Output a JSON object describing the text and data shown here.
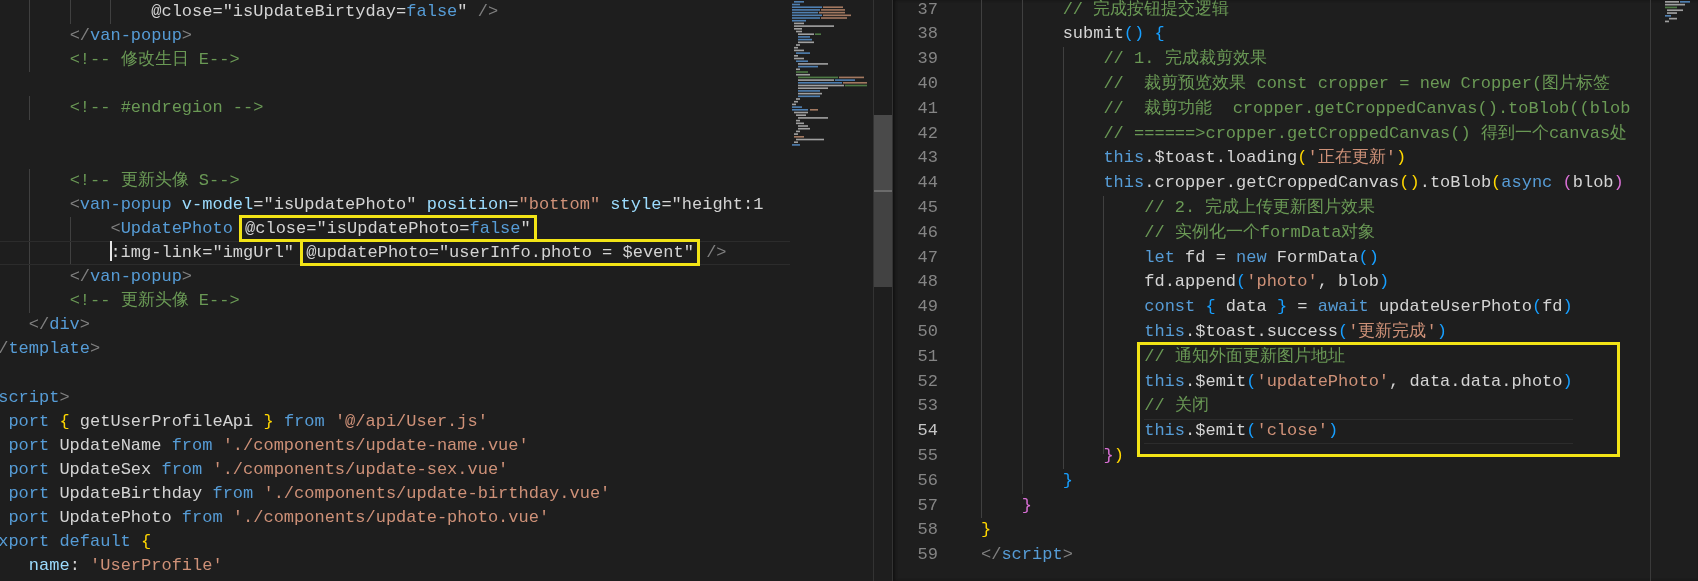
{
  "left_editor": {
    "lines": [
      {
        "current": false,
        "tokens": [
          {
            "kind": "text",
            "text": "                @close=\"isUpdateBirtyday="
          },
          {
            "kind": "keyword",
            "text": "false"
          },
          {
            "kind": "text",
            "text": "\""
          },
          {
            "kind": "punct",
            "text": " />"
          }
        ]
      },
      {
        "current": false,
        "tokens": [
          {
            "kind": "punct",
            "text": "        </"
          },
          {
            "kind": "tag",
            "text": "van-popup"
          },
          {
            "kind": "punct",
            "text": ">"
          }
        ]
      },
      {
        "current": false,
        "tokens": [
          {
            "kind": "comment",
            "text": "        <!-- 修改生日 E-->"
          }
        ]
      },
      {
        "current": false
      },
      {
        "current": false,
        "tokens": [
          {
            "kind": "comment",
            "text": "        <!-- #endregion -->"
          }
        ]
      },
      {
        "current": false
      },
      {
        "current": false
      },
      {
        "current": false,
        "tokens": [
          {
            "kind": "comment",
            "text": "        <!-- 更新头像 S-->"
          }
        ]
      },
      {
        "current": false,
        "tokens": [
          {
            "kind": "punct",
            "text": "        <"
          },
          {
            "kind": "tag",
            "text": "van-popup"
          },
          {
            "kind": "attr",
            "text": " v-model"
          },
          {
            "kind": "text",
            "text": "=\"isUpdatePhoto\""
          },
          {
            "kind": "attr",
            "text": " position"
          },
          {
            "kind": "text",
            "text": "="
          },
          {
            "kind": "string",
            "text": "\"bottom\""
          },
          {
            "kind": "attr",
            "text": " style"
          },
          {
            "kind": "text",
            "text": "=\"height:1"
          }
        ]
      },
      {
        "current": false,
        "tokens": [
          {
            "kind": "punct",
            "text": "            <"
          },
          {
            "kind": "tag",
            "text": "UpdatePhoto "
          },
          {
            "kind": "box",
            "tokens": [
              {
                "kind": "text",
                "text": "@close=\"isUpdatePhoto="
              },
              {
                "kind": "keyword",
                "text": "false"
              },
              {
                "kind": "text",
                "text": "\""
              }
            ]
          }
        ]
      },
      {
        "current": true,
        "tokens": [
          {
            "kind": "text",
            "text": "            :img-link=\"imgUrl\" "
          },
          {
            "kind": "box",
            "tokens": [
              {
                "kind": "text",
                "text": "@updatePhoto=\"userInfo.photo = $event\""
              }
            ]
          },
          {
            "kind": "punct",
            "text": " />"
          }
        ]
      },
      {
        "current": false,
        "tokens": [
          {
            "kind": "punct",
            "text": "        </"
          },
          {
            "kind": "tag",
            "text": "van-popup"
          },
          {
            "kind": "punct",
            "text": ">"
          }
        ]
      },
      {
        "current": false,
        "tokens": [
          {
            "kind": "comment",
            "text": "        <!-- 更新头像 E-->"
          }
        ]
      },
      {
        "current": false,
        "tokens": [
          {
            "kind": "punct",
            "text": "    </"
          },
          {
            "kind": "tag",
            "text": "div"
          },
          {
            "kind": "punct",
            "text": ">"
          }
        ]
      },
      {
        "current": false,
        "tokens": [
          {
            "kind": "punct",
            "text": " /"
          },
          {
            "kind": "tag",
            "text": "template"
          },
          {
            "kind": "punct",
            "text": ">"
          }
        ]
      },
      {
        "current": false
      },
      {
        "current": false,
        "tokens": [
          {
            "kind": "tag",
            "text": " script"
          },
          {
            "kind": "punct",
            "text": ">"
          }
        ]
      },
      {
        "current": false,
        "tokens": [
          {
            "kind": "keyword",
            "text": "  port "
          },
          {
            "kind": "bracket_gold",
            "text": "{"
          },
          {
            "kind": "text",
            "text": " getUserProfileApi "
          },
          {
            "kind": "bracket_gold",
            "text": "} "
          },
          {
            "kind": "keyword",
            "text": "from "
          },
          {
            "kind": "string",
            "text": "'@/api/User.js'"
          }
        ]
      },
      {
        "current": false,
        "tokens": [
          {
            "kind": "keyword",
            "text": "  port"
          },
          {
            "kind": "text",
            "text": " UpdateName "
          },
          {
            "kind": "keyword",
            "text": "from "
          },
          {
            "kind": "string",
            "text": "'./components/update-name.vue'"
          }
        ]
      },
      {
        "current": false,
        "tokens": [
          {
            "kind": "keyword",
            "text": "  port"
          },
          {
            "kind": "text",
            "text": " UpdateSex "
          },
          {
            "kind": "keyword",
            "text": "from "
          },
          {
            "kind": "string",
            "text": "'./components/update-sex.vue'"
          }
        ]
      },
      {
        "current": false,
        "tokens": [
          {
            "kind": "keyword",
            "text": "  port"
          },
          {
            "kind": "text",
            "text": " UpdateBirthday "
          },
          {
            "kind": "keyword",
            "text": "from "
          },
          {
            "kind": "string",
            "text": "'./components/update-birthday.vue'"
          }
        ]
      },
      {
        "current": false,
        "tokens": [
          {
            "kind": "keyword",
            "text": "  port"
          },
          {
            "kind": "text",
            "text": " UpdatePhoto "
          },
          {
            "kind": "keyword",
            "text": "from "
          },
          {
            "kind": "string",
            "text": "'./components/update-photo.vue'"
          }
        ]
      },
      {
        "current": false,
        "tokens": [
          {
            "kind": "keyword",
            "text": " xport default "
          },
          {
            "kind": "bracket_gold",
            "text": "{"
          }
        ]
      },
      {
        "current": false,
        "tokens": [
          {
            "kind": "attr",
            "text": "    name"
          },
          {
            "kind": "text",
            "text": ": "
          },
          {
            "kind": "string",
            "text": "'UserProfile'"
          }
        ]
      }
    ]
  },
  "right_editor": {
    "lines": [
      {
        "kind": "line",
        "number": "37",
        "current": false,
        "tokens": [
          {
            "kind": "comment",
            "text": "        // 完成按钮提交逻辑"
          }
        ]
      },
      {
        "kind": "line",
        "number": "38",
        "current": false,
        "tokens": [
          {
            "kind": "text",
            "text": "        submit"
          },
          {
            "kind": "bracket_blue",
            "text": "() "
          },
          {
            "kind": "bracket_blue",
            "text": "{"
          }
        ]
      },
      {
        "kind": "line",
        "number": "39",
        "current": false,
        "tokens": [
          {
            "kind": "comment",
            "text": "            // 1. 完成裁剪效果"
          }
        ]
      },
      {
        "kind": "line",
        "number": "40",
        "current": false,
        "tokens": [
          {
            "kind": "comment",
            "text": "            //  裁剪预览效果 const cropper = new Cropper(图片标签"
          }
        ]
      },
      {
        "kind": "line",
        "number": "41",
        "current": false,
        "tokens": [
          {
            "kind": "comment",
            "text": "            //  裁剪功能  cropper.getCroppedCanvas().toBlob((blob"
          }
        ]
      },
      {
        "kind": "line",
        "number": "42",
        "current": false,
        "tokens": [
          {
            "kind": "comment",
            "text": "            // ======>cropper.getCroppedCanvas() 得到一个canvas处"
          }
        ]
      },
      {
        "kind": "line",
        "number": "43",
        "current": false,
        "tokens": [
          {
            "kind": "keyword",
            "text": "            this"
          },
          {
            "kind": "text",
            "text": ".$toast.loading"
          },
          {
            "kind": "bracket_gold",
            "text": "("
          },
          {
            "kind": "string",
            "text": "'正在更新'"
          },
          {
            "kind": "bracket_gold",
            "text": ")"
          }
        ]
      },
      {
        "kind": "line",
        "number": "44",
        "current": false,
        "tokens": [
          {
            "kind": "keyword",
            "text": "            this"
          },
          {
            "kind": "text",
            "text": ".cropper.getCroppedCanvas"
          },
          {
            "kind": "bracket_gold",
            "text": "()"
          },
          {
            "kind": "text",
            "text": ".toBlob"
          },
          {
            "kind": "bracket_gold",
            "text": "("
          },
          {
            "kind": "keyword",
            "text": "async "
          },
          {
            "kind": "bracket_pink",
            "text": "("
          },
          {
            "kind": "text",
            "text": "blob"
          },
          {
            "kind": "bracket_pink",
            "text": ")"
          }
        ]
      },
      {
        "kind": "line",
        "number": "45",
        "current": false,
        "tokens": [
          {
            "kind": "comment",
            "text": "                // 2. 完成上传更新图片效果"
          }
        ]
      },
      {
        "kind": "line",
        "number": "46",
        "current": false,
        "tokens": [
          {
            "kind": "comment",
            "text": "                // 实例化一个formData对象"
          }
        ]
      },
      {
        "kind": "line",
        "number": "47",
        "current": false,
        "tokens": [
          {
            "kind": "keyword",
            "text": "                let"
          },
          {
            "kind": "text",
            "text": " fd = "
          },
          {
            "kind": "keyword",
            "text": "new"
          },
          {
            "kind": "text",
            "text": " FormData"
          },
          {
            "kind": "bracket_blue",
            "text": "()"
          }
        ]
      },
      {
        "kind": "line",
        "number": "48",
        "current": false,
        "tokens": [
          {
            "kind": "text",
            "text": "                fd.append"
          },
          {
            "kind": "bracket_blue",
            "text": "("
          },
          {
            "kind": "string",
            "text": "'photo'"
          },
          {
            "kind": "text",
            "text": ", blob"
          },
          {
            "kind": "bracket_blue",
            "text": ")"
          }
        ]
      },
      {
        "kind": "line",
        "number": "49",
        "current": false,
        "tokens": [
          {
            "kind": "keyword",
            "text": "                const "
          },
          {
            "kind": "bracket_blue",
            "text": "{"
          },
          {
            "kind": "text",
            "text": " data "
          },
          {
            "kind": "bracket_blue",
            "text": "}"
          },
          {
            "kind": "text",
            "text": " = "
          },
          {
            "kind": "keyword",
            "text": "await"
          },
          {
            "kind": "text",
            "text": " updateUserPhoto"
          },
          {
            "kind": "bracket_blue",
            "text": "("
          },
          {
            "kind": "text",
            "text": "fd"
          },
          {
            "kind": "bracket_blue",
            "text": ")"
          }
        ]
      },
      {
        "kind": "line",
        "number": "50",
        "current": false,
        "tokens": [
          {
            "kind": "keyword",
            "text": "                this"
          },
          {
            "kind": "text",
            "text": ".$toast.success"
          },
          {
            "kind": "bracket_blue",
            "text": "("
          },
          {
            "kind": "string",
            "text": "'更新完成'"
          },
          {
            "kind": "bracket_blue",
            "text": ")"
          }
        ]
      },
      {
        "kind": "box",
        "lines": [
          {
            "number": "51",
            "current": false,
            "tokens": [
              {
                "kind": "comment",
                "text": "                // 通知外面更新图片地址"
              }
            ]
          },
          {
            "number": "52",
            "current": false,
            "tokens": [
              {
                "kind": "keyword",
                "text": "                this"
              },
              {
                "kind": "text",
                "text": ".$emit"
              },
              {
                "kind": "bracket_blue",
                "text": "("
              },
              {
                "kind": "string",
                "text": "'updatePhoto'"
              },
              {
                "kind": "text",
                "text": ", data.data.photo"
              },
              {
                "kind": "bracket_blue",
                "text": ")"
              }
            ]
          },
          {
            "number": "53",
            "current": false,
            "tokens": [
              {
                "kind": "comment",
                "text": "                // 关闭"
              }
            ]
          },
          {
            "number": "54",
            "current": true,
            "tokens": [
              {
                "kind": "keyword",
                "text": "                this"
              },
              {
                "kind": "text",
                "text": ".$emit"
              },
              {
                "kind": "bracket_blue",
                "text": "("
              },
              {
                "kind": "string",
                "text": "'close'"
              },
              {
                "kind": "bracket_blue",
                "text": ")"
              }
            ]
          }
        ]
      },
      {
        "kind": "line",
        "number": "55",
        "current": false,
        "tokens": [
          {
            "kind": "bracket_pink",
            "text": "            }"
          },
          {
            "kind": "bracket_gold",
            "text": ")"
          }
        ]
      },
      {
        "kind": "line",
        "number": "56",
        "current": false,
        "tokens": [
          {
            "kind": "bracket_blue",
            "text": "        }"
          }
        ]
      },
      {
        "kind": "line",
        "number": "57",
        "current": false,
        "tokens": [
          {
            "kind": "bracket_pink",
            "text": "    }"
          }
        ]
      },
      {
        "kind": "line",
        "number": "58",
        "current": false,
        "tokens": [
          {
            "kind": "bracket_gold",
            "text": "}"
          }
        ]
      },
      {
        "kind": "line",
        "number": "59",
        "current": false,
        "tokens": [
          {
            "kind": "punct",
            "text": "</"
          },
          {
            "kind": "tag",
            "text": "script"
          },
          {
            "kind": "punct",
            "text": ">"
          }
        ]
      }
    ]
  }
}
